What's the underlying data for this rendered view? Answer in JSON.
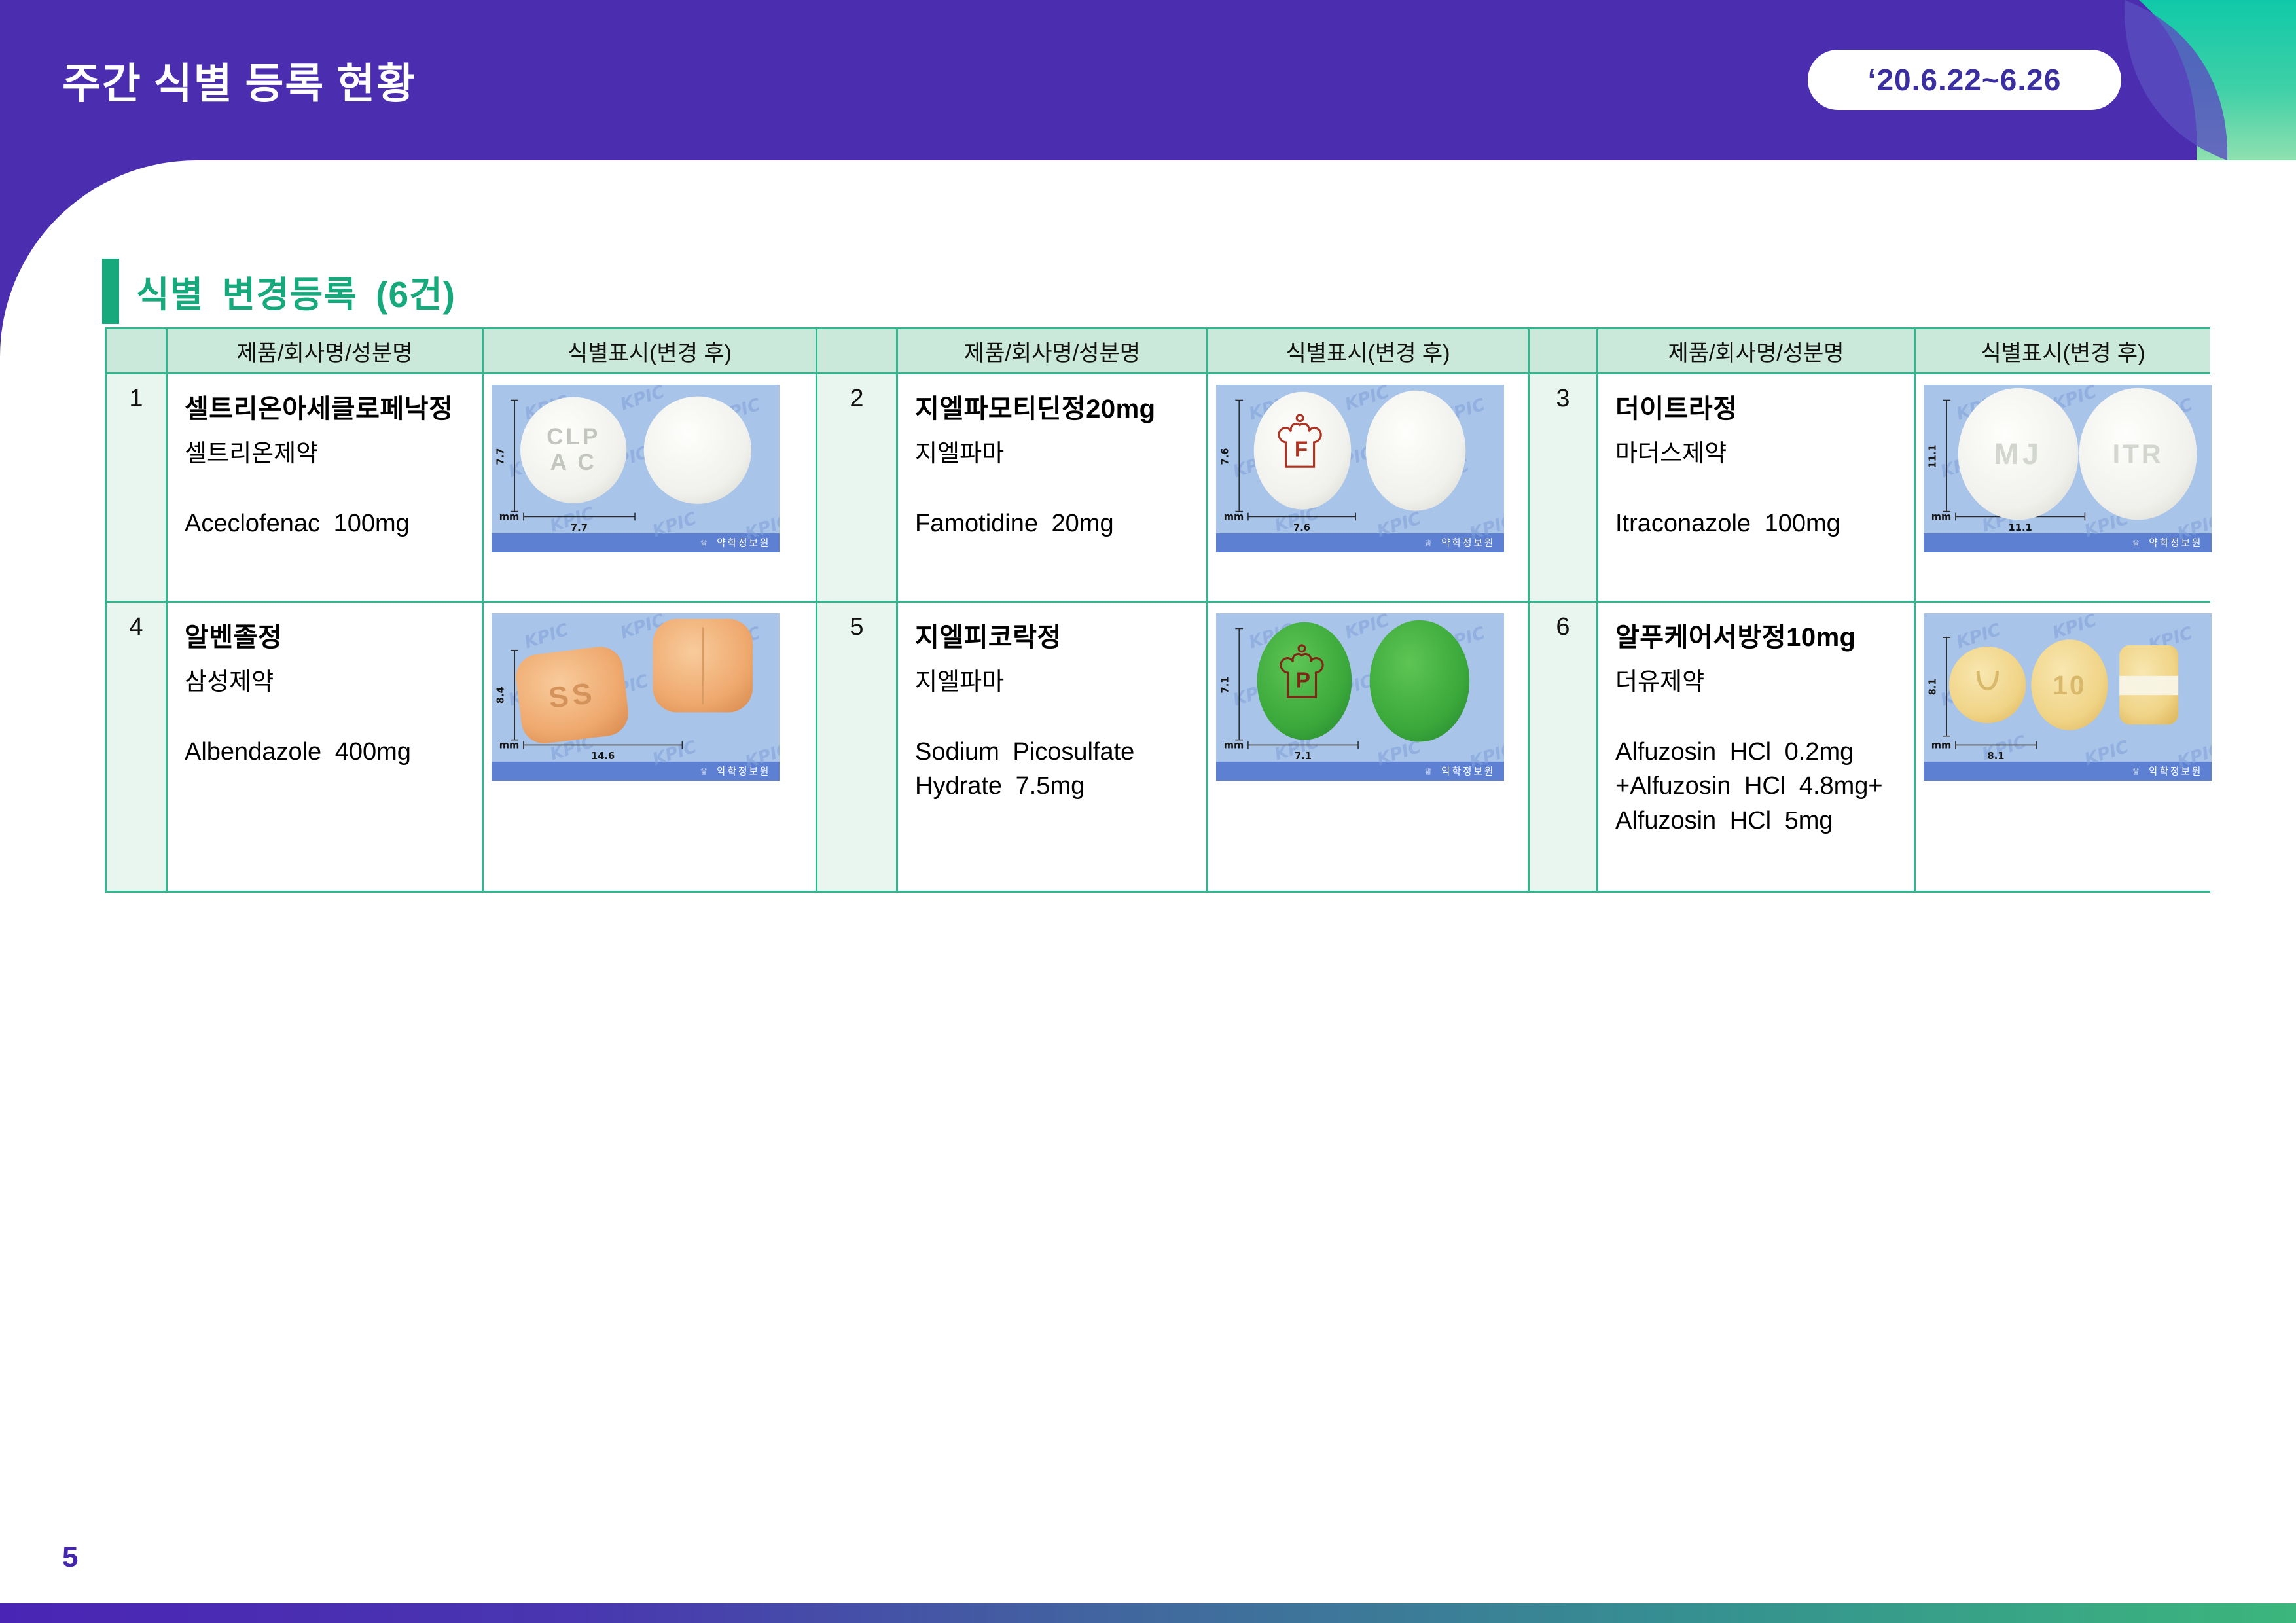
{
  "header": {
    "title": "주간 식별 등록 현황",
    "date_badge": "‘20.6.22~6.26"
  },
  "section": {
    "title": "식별 변경등록 (6건)"
  },
  "table": {
    "col_product": "제품/회사명/성분명",
    "col_mark": "식별표시(변경 후)",
    "pill_common": {
      "unit": "mm",
      "watermark": "KPIC",
      "brand": "약학정보원",
      "logo_glyph": "♕"
    },
    "entries": [
      {
        "num": "1",
        "name": "셀트리온아세클로페낙정",
        "company": "셀트리온제약",
        "ingredient_lines": [
          "Aceclofenac 100mg",
          "",
          ""
        ],
        "pill": {
          "vsize": "7.7",
          "hsize": "7.7",
          "engravings": [
            "CLP",
            "A C"
          ]
        }
      },
      {
        "num": "2",
        "name": "지엘파모티딘정20mg",
        "company": "지엘파마",
        "ingredient_lines": [
          "Famotidine 20mg",
          "",
          ""
        ],
        "pill": {
          "vsize": "7.6",
          "hsize": "7.6",
          "crown_letter": "F"
        }
      },
      {
        "num": "3",
        "name": "더이트라정",
        "company": "마더스제약",
        "ingredient_lines": [
          "Itraconazole 100mg",
          "",
          ""
        ],
        "pill": {
          "vsize": "11.1",
          "hsize": "11.1",
          "engravings": [
            "MJ",
            "ITR"
          ]
        }
      },
      {
        "num": "4",
        "name": "알벤졸정",
        "company": "삼성제약",
        "ingredient_lines": [
          "Albendazole 400mg",
          "",
          ""
        ],
        "pill": {
          "vsize": "8.4",
          "hsize": "14.6",
          "engravings": [
            "SS"
          ]
        }
      },
      {
        "num": "5",
        "name": "지엘피코락정",
        "company": "지엘파마",
        "ingredient_lines": [
          "Sodium Picosulfate",
          "Hydrate 7.5mg",
          ""
        ],
        "pill": {
          "vsize": "7.1",
          "hsize": "7.1",
          "crown_letter": "P"
        }
      },
      {
        "num": "6",
        "name": "알푸케어서방정10mg",
        "company": "더유제약",
        "ingredient_lines": [
          "Alfuzosin HCl 0.2mg",
          "+Alfuzosin HCl 4.8mg+",
          "Alfuzosin HCl 5mg"
        ],
        "pill": {
          "vsize": "8.1",
          "hsize": "8.1",
          "engravings": [
            "10"
          ]
        }
      }
    ]
  },
  "footer": {
    "page_number": "5"
  },
  "colors": {
    "header_purple": "#4b2db0",
    "accent_teal": "#14c9a6",
    "section_green": "#17a97c",
    "table_border_green": "#35b58d",
    "header_cell_mint": "#cbe9da",
    "num_cell_mint": "#e9f6ef",
    "pill_bg_blue": "#a9c4e9",
    "pill_strip_blue": "#5d80d2",
    "badge_text_purple": "#3b2fa0",
    "footer_gradient": [
      "#4a25b5",
      "#41699e",
      "#3cb67c"
    ]
  }
}
